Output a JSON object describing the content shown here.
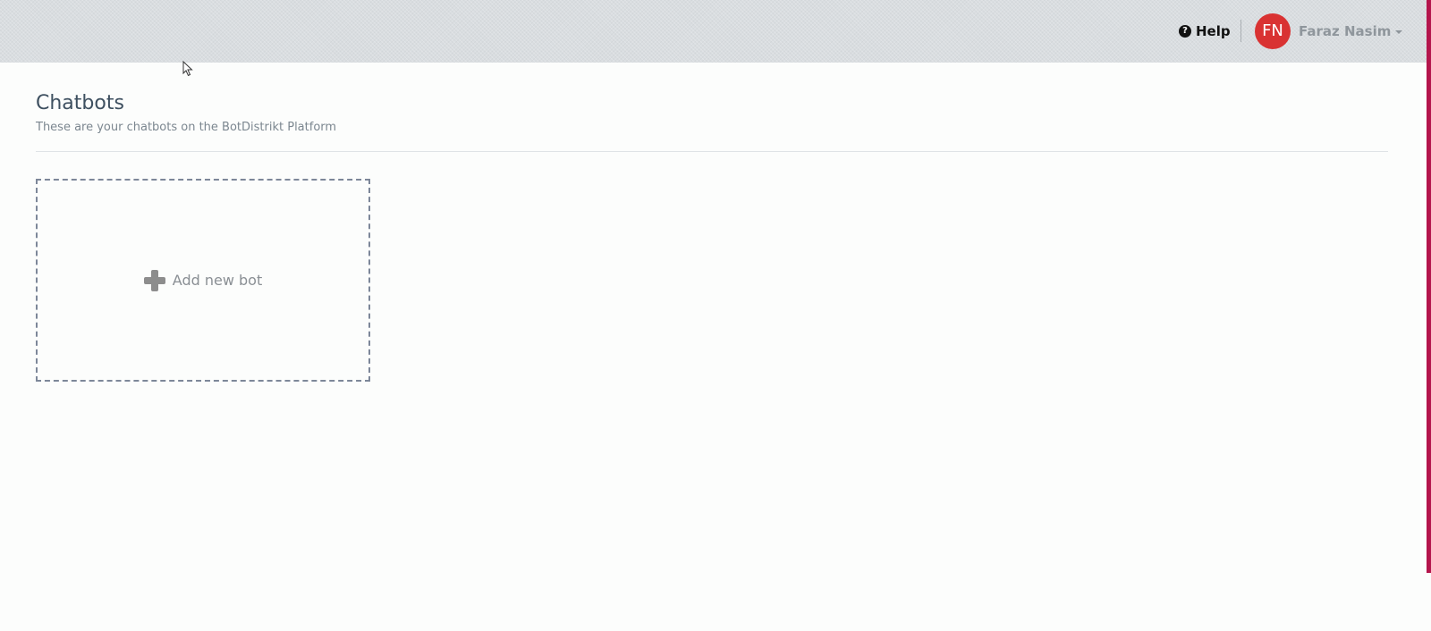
{
  "header": {
    "help_label": "Help",
    "help_icon": "question-circle-icon",
    "user": {
      "initials": "FN",
      "name": "Faraz Nasim",
      "avatar_color": "#d93232"
    }
  },
  "page": {
    "title": "Chatbots",
    "subtitle": "These are your chatbots on the BotDistrikt Platform"
  },
  "add_bot": {
    "label": "Add new bot",
    "icon": "plus-icon"
  },
  "colors": {
    "accent": "#b4154c",
    "header_bg": "#d9dde0"
  }
}
